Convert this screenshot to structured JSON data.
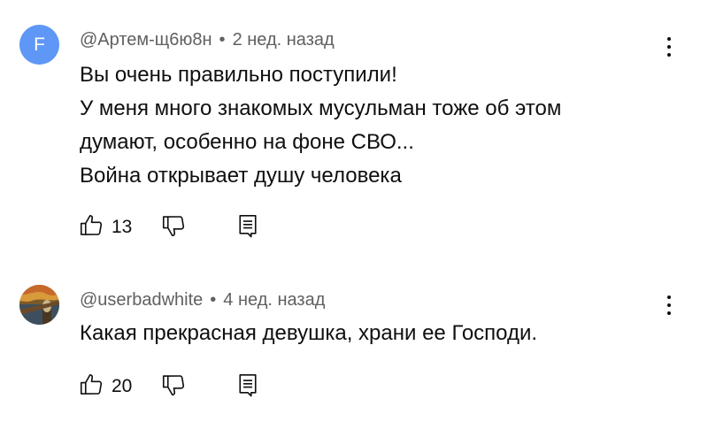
{
  "comments": [
    {
      "avatar_letter": "F",
      "avatar_color": "#5e97f6",
      "author": "@Артем-щ6ю8н",
      "separator": "•",
      "time": "2 нед. назад",
      "lines": [
        "Вы очень правильно поступили!",
        "У меня много знакомых мусульман тоже об этом",
        "думают, особенно на фоне СВО...",
        "Война открывает душу человека"
      ],
      "likes": "13",
      "icons": [
        "thumb-up-icon",
        "thumb-down-icon",
        "reply-icon",
        "more-vert-icon"
      ]
    },
    {
      "avatar_image": "painting-avatar",
      "author": "@userbadwhite",
      "separator": "•",
      "time": "4 нед. назад",
      "lines": [
        "Какая прекрасная девушка, храни ее Господи."
      ],
      "likes": "20",
      "icons": [
        "thumb-up-icon",
        "thumb-down-icon",
        "reply-icon",
        "more-vert-icon"
      ]
    }
  ]
}
